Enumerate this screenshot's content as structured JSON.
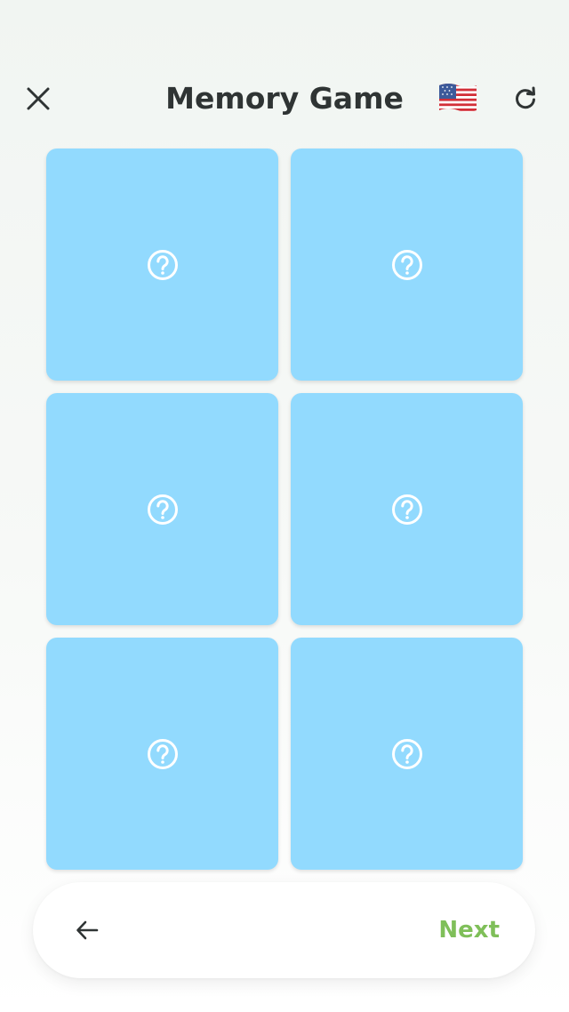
{
  "header": {
    "title": "Memory Game",
    "close_icon": "close-icon",
    "language_icon": "us-flag-icon",
    "refresh_icon": "refresh-icon"
  },
  "cards": [
    {
      "state": "hidden",
      "icon": "question-circle-icon"
    },
    {
      "state": "hidden",
      "icon": "question-circle-icon"
    },
    {
      "state": "hidden",
      "icon": "question-circle-icon"
    },
    {
      "state": "hidden",
      "icon": "question-circle-icon"
    },
    {
      "state": "hidden",
      "icon": "question-circle-icon"
    },
    {
      "state": "hidden",
      "icon": "question-circle-icon"
    }
  ],
  "footer": {
    "back_icon": "arrow-left-icon",
    "next_label": "Next"
  },
  "colors": {
    "card": "#92dafe",
    "title": "#2f3434",
    "next": "#7fbf59",
    "icon_dark": "#2f3434"
  }
}
